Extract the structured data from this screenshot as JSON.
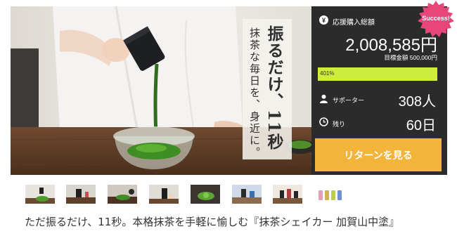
{
  "hero": {
    "headline": "振るだけ、11秒",
    "subline": "抹茶な毎日を、身近に。"
  },
  "panel": {
    "amount_label": "応援購入総額",
    "amount": "2,008,585円",
    "goal": "目標金額 500,000円",
    "progress_percent": 401,
    "progress_label": "401%",
    "supporters_label": "サポーター",
    "supporters_value": "308人",
    "remaining_label": "残り",
    "remaining_value": "60日",
    "return_button": "リターンを見る",
    "badge": "Success!"
  },
  "colors": {
    "panel_bg": "#2b2b2b",
    "progress": "#cdec3c",
    "button": "#f2b43a",
    "badge": "#e8457a"
  },
  "thumbnails": [
    {
      "name": "thumb-1"
    },
    {
      "name": "thumb-2"
    },
    {
      "name": "thumb-3"
    },
    {
      "name": "thumb-4"
    },
    {
      "name": "thumb-5"
    },
    {
      "name": "thumb-6"
    },
    {
      "name": "thumb-7"
    },
    {
      "name": "thumb-8"
    }
  ],
  "project": {
    "title": "ただ振るだけ、11秒。本格抹茶を手軽に愉しむ『抹茶シェイカー 加賀山中塗』"
  }
}
